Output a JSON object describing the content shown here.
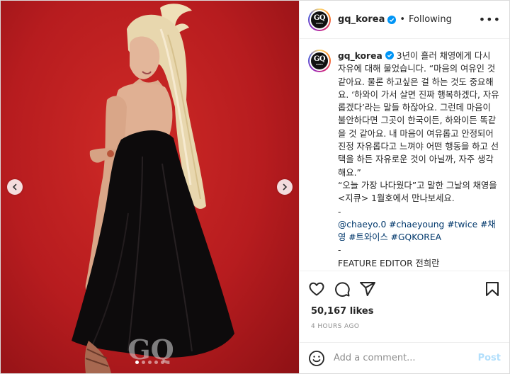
{
  "post": {
    "username": "gq_korea",
    "following_label": "Following",
    "separator": "•",
    "more_label": "•••",
    "avatar": {
      "logo": "GQ",
      "sub": "KOREA"
    },
    "watermark": "GQ",
    "carousel": {
      "index": 1,
      "count": 5
    }
  },
  "caption": {
    "username": "gq_korea",
    "text": "3년이 흘러 채영에게 다시 자유에 대해 물었습니다. “마음의 여유인 것 같아요. 물론 하고싶은 걸 하는 것도 중요해요. ‘하와이 가서 살면 진짜 행복하겠다, 자유롭겠다’라는 말들 하잖아요. 그런데 마음이 불안하다면 그곳이 한국이든, 하와이든 똑같을 것 같아요. 내 마음이 여유롭고 안정되어 진정 자유롭다고 느껴야 어떤 행동을 하고 선택을 하든 자유로운 것이 아닐까, 자주 생각해요.”\n“오늘 가장 나다웠다”고 말한 그날의 채영을 <지큐> 1월호에서 만나보세요.\n-",
    "tags": "@chaeyo.0 #chaeyoung #twice #채영 #트와이스 #GQKOREA",
    "credits": "-\nFEATURE EDITOR 전희란\nPHOTOGRAPHER 장덕화\n@jangdukhwa"
  },
  "stats": {
    "likes": "50,167 likes",
    "timestamp": "4 HOURS AGO"
  },
  "comment": {
    "placeholder": "Add a comment...",
    "post_label": "Post"
  },
  "icons": {
    "like": "heart-icon",
    "comment": "comment-icon",
    "share": "paper-plane-icon",
    "save": "bookmark-icon",
    "emoji": "smiley-icon",
    "verified": "verified-badge-icon",
    "prev": "chevron-left-icon",
    "next": "chevron-right-icon"
  },
  "colors": {
    "background_red": "#b81a1e",
    "verified_blue": "#0095f6",
    "link": "#00376b",
    "post_disabled": "#b2dffc",
    "muted": "#8e8e8e"
  }
}
